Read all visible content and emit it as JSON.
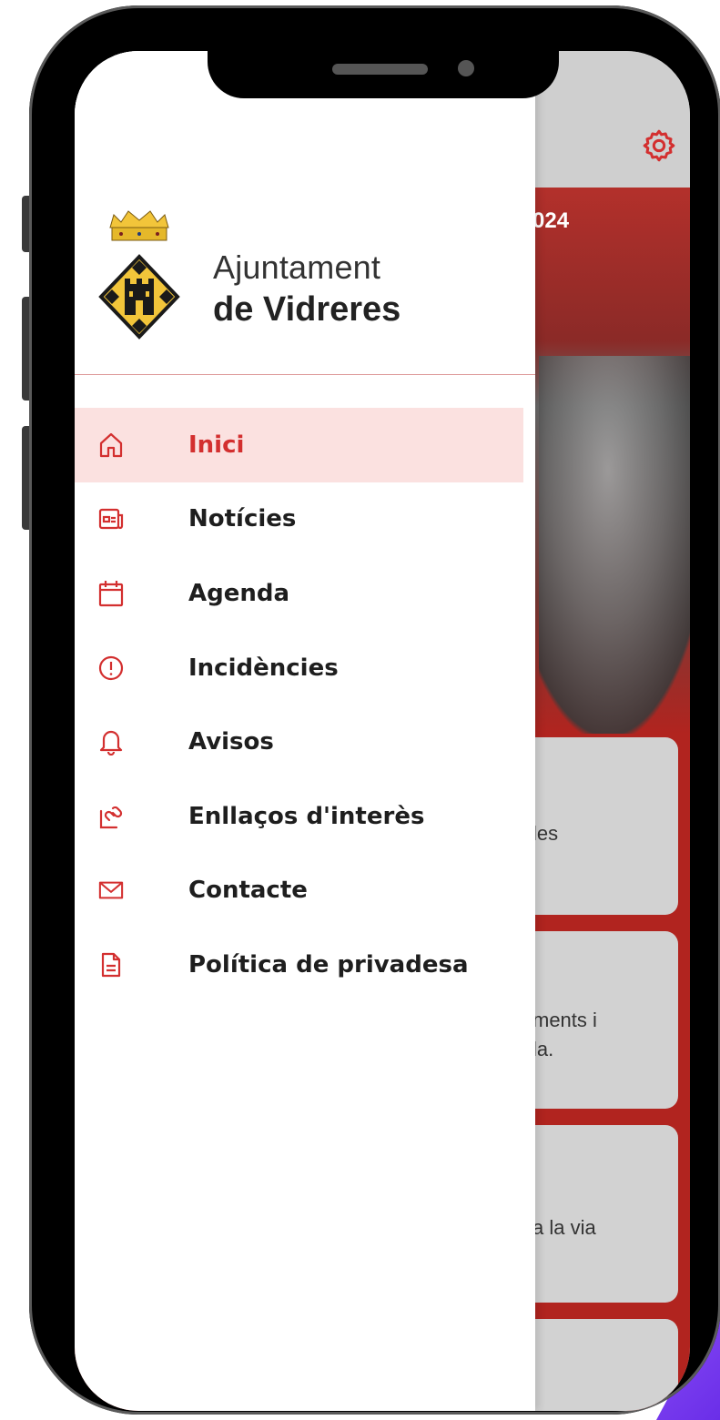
{
  "colors": {
    "accent": "#d32f2f",
    "active_bg": "#fbe1e0",
    "frame": "#000000"
  },
  "background_app": {
    "banner_text": "024",
    "cards": [
      {
        "lines": [
          "les"
        ]
      },
      {
        "lines": [
          "ments i",
          "la."
        ]
      },
      {
        "lines": [
          "a la via"
        ]
      },
      {
        "lines": []
      }
    ],
    "settings_icon": "gear-icon"
  },
  "drawer": {
    "logo": {
      "line1": "Ajuntament",
      "line2": "de Vidreres"
    },
    "menu": [
      {
        "label": "Inici",
        "icon": "home-icon",
        "active": true
      },
      {
        "label": "Notícies",
        "icon": "newspaper-icon",
        "active": false
      },
      {
        "label": "Agenda",
        "icon": "calendar-icon",
        "active": false
      },
      {
        "label": "Incidències",
        "icon": "alert-icon",
        "active": false
      },
      {
        "label": "Avisos",
        "icon": "bell-icon",
        "active": false
      },
      {
        "label": "Enllaços d'interès",
        "icon": "link-icon",
        "active": false
      },
      {
        "label": "Contacte",
        "icon": "mail-icon",
        "active": false
      },
      {
        "label": "Política de privadesa",
        "icon": "document-icon",
        "active": false
      }
    ]
  }
}
